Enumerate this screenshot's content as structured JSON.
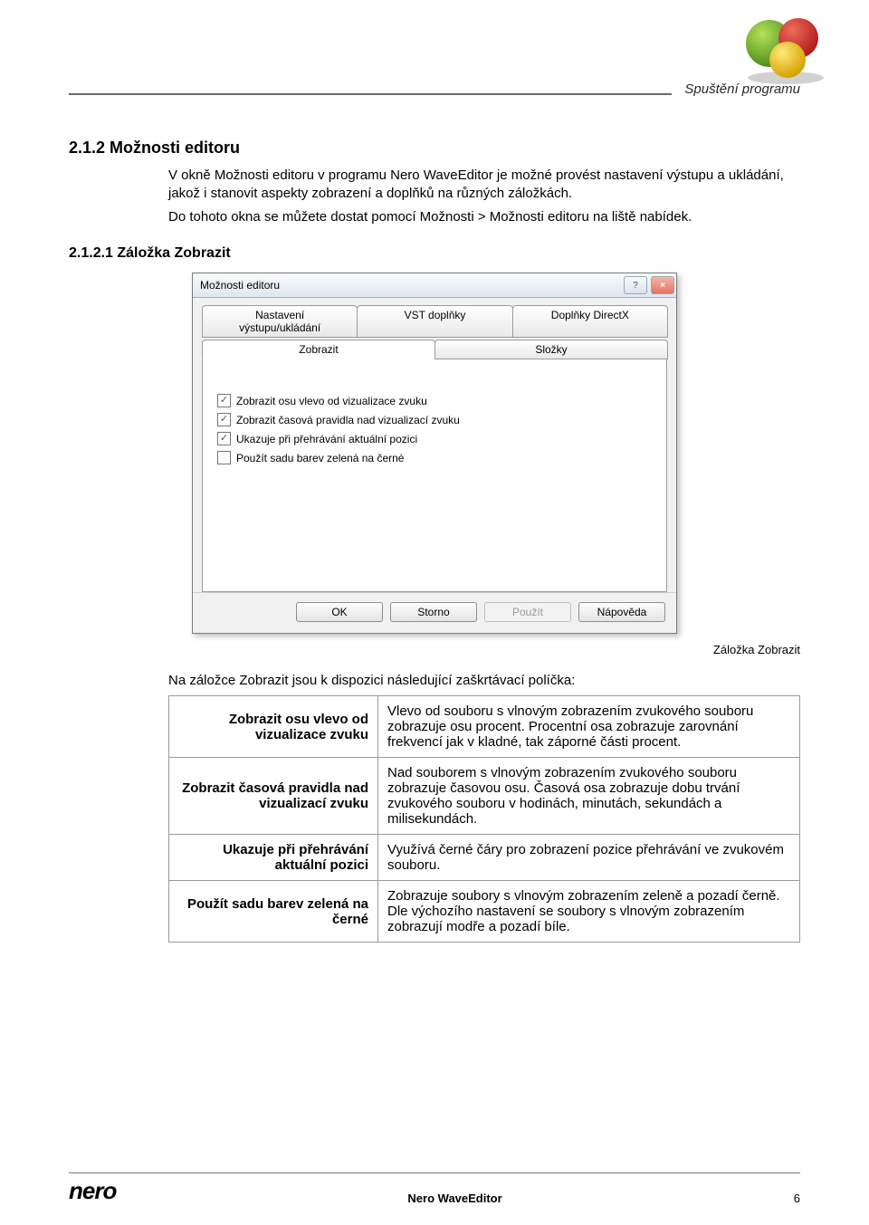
{
  "header": {
    "section_name": "Spuštění programu"
  },
  "section": {
    "number_title": "2.1.2  Možnosti editoru",
    "para1": "V okně Možnosti editoru v programu Nero WaveEditor je možné provést nastavení výstupu a ukládání, jakož i stanovit aspekty zobrazení a doplňků na různých záložkách.",
    "para2": "Do tohoto okna se můžete dostat pomocí Možnosti > Možnosti editoru na liště nabídek.",
    "subsection_title": "2.1.2.1 Záložka Zobrazit"
  },
  "dialog": {
    "title": "Možnosti editoru",
    "winbuttons": {
      "help": "?",
      "close": "×"
    },
    "tabs_row1": [
      "Nastavení výstupu/ukládání",
      "VST doplňky",
      "Doplňky DirectX"
    ],
    "tabs_row2": [
      "Zobrazit",
      "Složky"
    ],
    "active_tab": "Zobrazit",
    "checkboxes": [
      {
        "label": "Zobrazit osu vlevo od vizualizace zvuku",
        "checked": true
      },
      {
        "label": "Zobrazit časová pravidla nad vizualizací zvuku",
        "checked": true
      },
      {
        "label": "Ukazuje při přehrávání aktuální pozici",
        "checked": true
      },
      {
        "label": "Použít sadu barev zelená na černé",
        "checked": false
      }
    ],
    "buttons": {
      "ok": "OK",
      "cancel": "Storno",
      "apply": "Použít",
      "help": "Nápověda"
    }
  },
  "caption": "Záložka Zobrazit",
  "table_intro": "Na záložce Zobrazit jsou k dispozici následující zaškrtávací políčka:",
  "options_table": [
    {
      "label": "Zobrazit osu vlevo od vizualizace zvuku",
      "desc": "Vlevo od souboru s vlnovým zobrazením zvukového souboru zobrazuje osu procent. Procentní osa zobrazuje zarovnání frekvencí jak v kladné, tak záporné části procent."
    },
    {
      "label": "Zobrazit časová pravidla nad vizualizací zvuku",
      "desc": "Nad souborem s vlnovým zobrazením zvukového souboru zobrazuje časovou osu. Časová osa zobrazuje dobu trvání zvukového souboru v hodinách, minutách, sekundách a milisekundách."
    },
    {
      "label": "Ukazuje při přehrávání aktuální pozici",
      "desc": "Využívá černé čáry pro zobrazení pozice přehrávání ve zvukovém souboru."
    },
    {
      "label": "Použít sadu barev zelená na černé",
      "desc": "Zobrazuje soubory s vlnovým zobrazením zeleně a pozadí černě. Dle výchozího nastavení se soubory s vlnovým zobrazením zobrazují modře a pozadí bíle."
    }
  ],
  "footer": {
    "brand": "nero",
    "product": "Nero WaveEditor",
    "page": "6"
  }
}
